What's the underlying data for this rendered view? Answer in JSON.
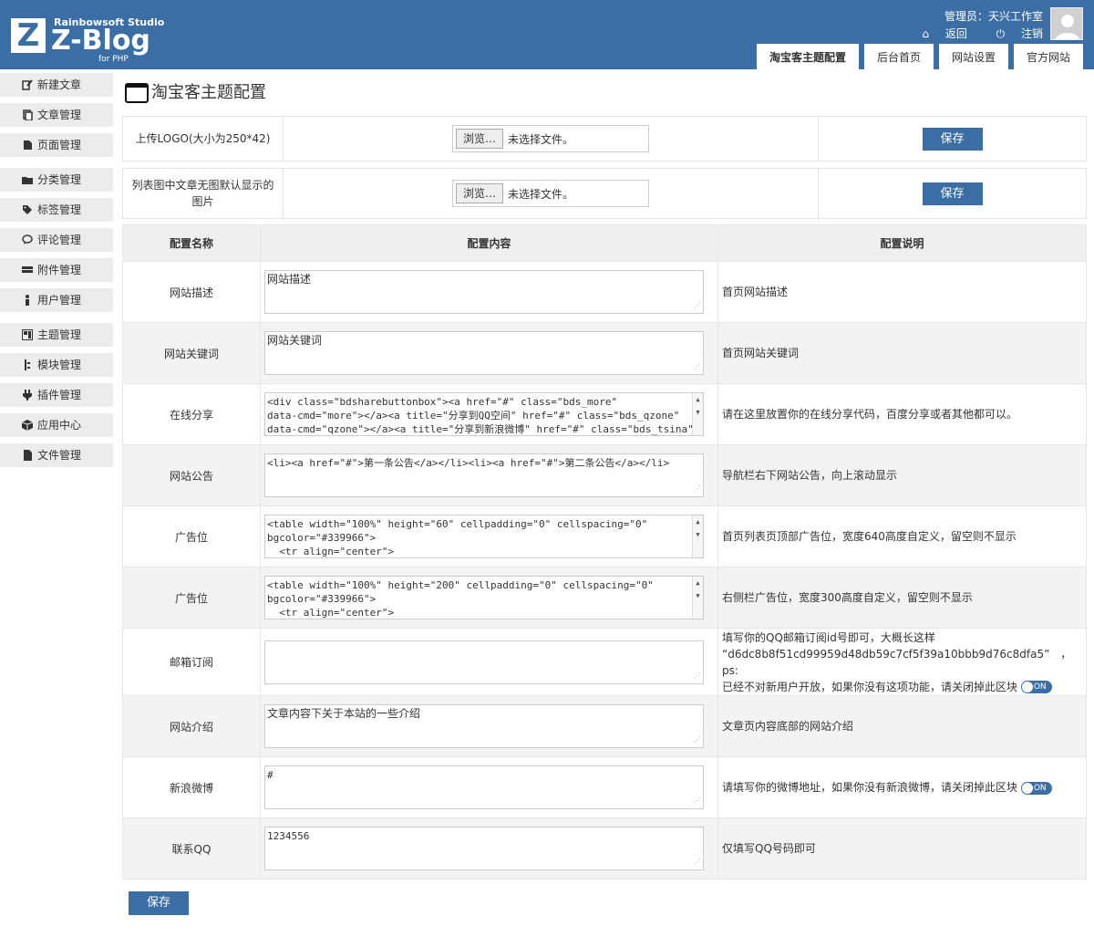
{
  "header": {
    "logo_studio": "Rainbowsoft Studio",
    "logo_name": "Z-Blog",
    "logo_sub": "for PHP",
    "admin_text": "管理员：天兴工作室",
    "back_label": "返回",
    "logout_label": "注销",
    "tabs": [
      {
        "label": "淘宝客主题配置"
      },
      {
        "label": "后台首页"
      },
      {
        "label": "网站设置"
      },
      {
        "label": "官方网站"
      }
    ]
  },
  "sidebar": {
    "items": [
      {
        "label": "新建文章"
      },
      {
        "label": "文章管理"
      },
      {
        "label": "页面管理"
      },
      {
        "label": "分类管理"
      },
      {
        "label": "标签管理"
      },
      {
        "label": "评论管理"
      },
      {
        "label": "附件管理"
      },
      {
        "label": "用户管理"
      },
      {
        "label": "主题管理"
      },
      {
        "label": "模块管理"
      },
      {
        "label": "插件管理"
      },
      {
        "label": "应用中心"
      },
      {
        "label": "文件管理"
      }
    ]
  },
  "main": {
    "title": "淘宝客主题配置",
    "uploads": [
      {
        "label": "上传LOGO(大小为250*42)",
        "browse": "浏览…",
        "file_status": "未选择文件。",
        "save": "保存"
      },
      {
        "label": "列表图中文章无图默认显示的图片",
        "browse": "浏览…",
        "file_status": "未选择文件。",
        "save": "保存"
      }
    ],
    "table": {
      "headers": [
        "配置名称",
        "配置内容",
        "配置说明"
      ],
      "rows": [
        {
          "name": "网站描述",
          "value": "网站描述",
          "desc": "首页网站描述"
        },
        {
          "name": "网站关键词",
          "value": "网站关键词",
          "desc": "首页网站关键词"
        },
        {
          "name": "在线分享",
          "value": "<div class=\"bdsharebuttonbox\"><a href=\"#\" class=\"bds_more\"\ndata-cmd=\"more\"></a><a title=\"分享到QQ空间\" href=\"#\" class=\"bds_qzone\"\ndata-cmd=\"qzone\"></a><a title=\"分享到新浪微博\" href=\"#\" class=\"bds_tsina\"",
          "desc": "请在这里放置你的在线分享代码，百度分享或者其他都可以。"
        },
        {
          "name": "网站公告",
          "value": "<li><a href=\"#\">第一条公告</a></li><li><a href=\"#\">第二条公告</a></li>",
          "desc": "导航栏右下网站公告，向上滚动显示"
        },
        {
          "name": "广告位",
          "value": "<table width=\"100%\" height=\"60\" cellpadding=\"0\" cellspacing=\"0\"\nbgcolor=\"#339966\">\n  <tr align=\"center\">",
          "desc": "首页列表页顶部广告位，宽度640高度自定义，留空则不显示"
        },
        {
          "name": "广告位",
          "value": "<table width=\"100%\" height=\"200\" cellpadding=\"0\" cellspacing=\"0\"\nbgcolor=\"#339966\">\n  <tr align=\"center\">",
          "desc": "右侧栏广告位，宽度300高度自定义，留空则不显示"
        },
        {
          "name": "邮箱订阅",
          "value": "",
          "desc_line1": "填写你的QQ邮箱订阅id号即可，大概长这样",
          "desc_line2": "“d6dc8b8f51cd99959d48db59c7cf5f39a10bbb9d76c8dfa5”　，ps:",
          "desc_line3": "已经不对新用户开放，如果你没有这项功能，请关闭掉此区块",
          "toggle": "ON"
        },
        {
          "name": "网站介绍",
          "value": "文章内容下关于本站的一些介绍",
          "desc": "文章页内容底部的网站介绍"
        },
        {
          "name": "新浪微博",
          "value": "#",
          "desc": "请填写你的微博地址，如果你没有新浪微博，请关闭掉此区块",
          "toggle": "ON"
        },
        {
          "name": "联系QQ",
          "value": "1234556",
          "desc": "仅填写QQ号码即可"
        }
      ]
    },
    "bottom_save": "保存"
  },
  "colors": {
    "brand": "#3a6ea5",
    "sidebar_bg": "#ececec"
  }
}
